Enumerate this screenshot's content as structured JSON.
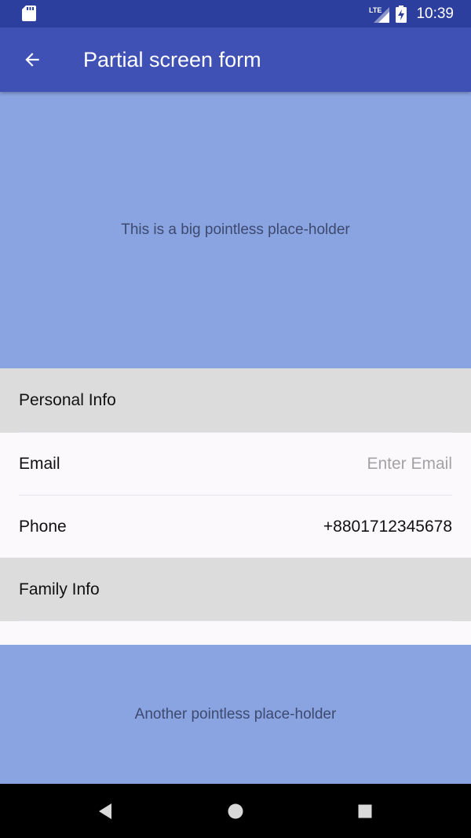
{
  "status_bar": {
    "time": "10:39",
    "network": "LTE",
    "icons": [
      "sd-card-icon",
      "signal-icon",
      "battery-charging-icon"
    ]
  },
  "app_bar": {
    "title": "Partial screen form",
    "back_icon": "arrow-back-icon"
  },
  "top_placeholder": {
    "text": "This is a big pointless place-holder"
  },
  "sections": [
    {
      "title": "Personal Info",
      "rows": [
        {
          "label": "Email",
          "value": "",
          "placeholder": "Enter Email"
        },
        {
          "label": "Phone",
          "value": "+8801712345678",
          "placeholder": ""
        }
      ]
    },
    {
      "title": "Family Info",
      "rows": []
    }
  ],
  "bottom_placeholder": {
    "text": "Another pointless place-holder"
  },
  "nav_bar": {
    "icons": [
      "back-triangle-icon",
      "home-circle-icon",
      "recents-square-icon"
    ]
  },
  "colors": {
    "status_bar": "#2c3f9e",
    "app_bar": "#3f51b5",
    "placeholder_bg": "#8aa4e2",
    "section_header_bg": "#dcdcdd",
    "row_bg": "#fbf9fc"
  }
}
